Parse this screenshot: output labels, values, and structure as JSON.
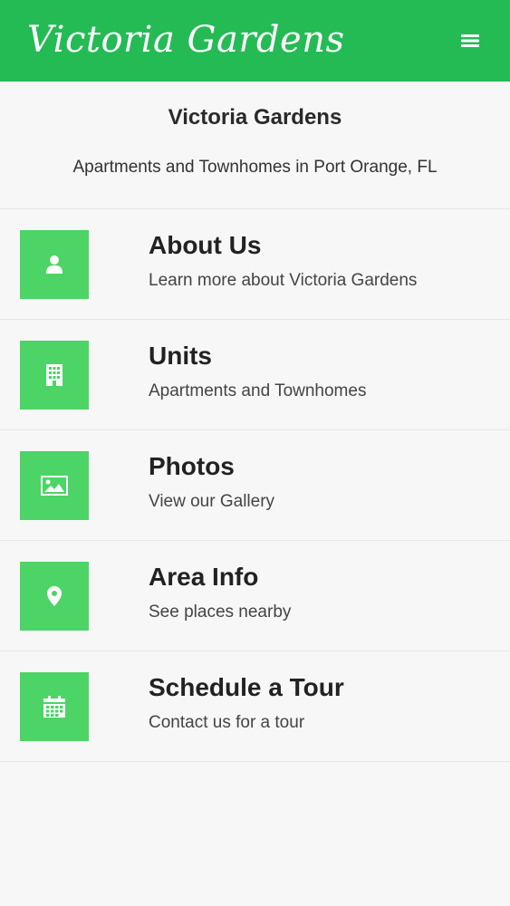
{
  "header": {
    "brand": "Victoria Gardens",
    "menu_icon": "hamburger-menu-icon",
    "color": "#24bb55"
  },
  "hero": {
    "title": "Victoria Gardens",
    "subtitle": "Apartments and Townhomes in Port Orange, FL"
  },
  "menu": {
    "tile_color": "#4cd466",
    "items": [
      {
        "icon": "user-icon",
        "title": "About Us",
        "subtitle": "Learn more about Victoria Gardens"
      },
      {
        "icon": "building-icon",
        "title": "Units",
        "subtitle": "Apartments and Townhomes"
      },
      {
        "icon": "image-icon",
        "title": "Photos",
        "subtitle": "View our Gallery"
      },
      {
        "icon": "map-pin-icon",
        "title": "Area Info",
        "subtitle": "See places nearby"
      },
      {
        "icon": "calendar-icon",
        "title": "Schedule a Tour",
        "subtitle": "Contact us for a tour"
      }
    ]
  }
}
